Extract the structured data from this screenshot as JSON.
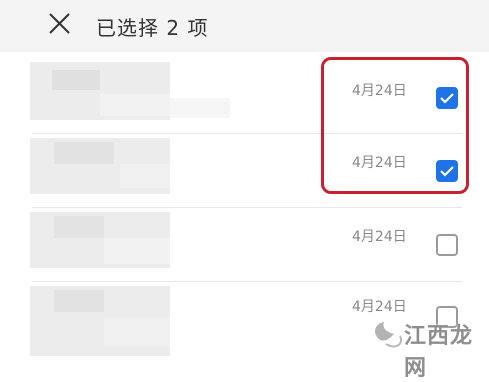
{
  "header": {
    "close_icon": "close-icon",
    "title": "已选择 2 项"
  },
  "rows": [
    {
      "date": "4月24日",
      "checked": true
    },
    {
      "date": "4月24日",
      "checked": true
    },
    {
      "date": "4月24日",
      "checked": false
    },
    {
      "date": "4月24日",
      "checked": false
    }
  ],
  "colors": {
    "accent": "#1f73e6",
    "highlight": "#c8202f",
    "header_bg": "#f4f4f4"
  },
  "watermark": {
    "text": "江西龙网"
  }
}
